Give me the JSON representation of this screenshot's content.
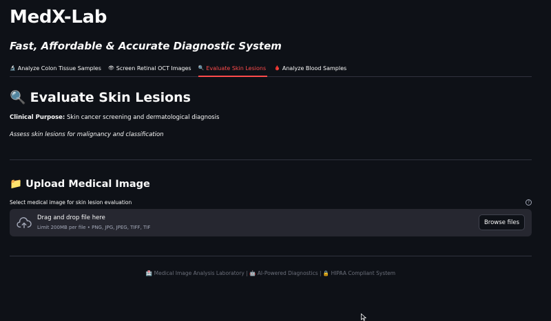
{
  "app": {
    "title": "MedX-Lab",
    "subtitle": "Fast, Affordable & Accurate Diagnostic System"
  },
  "tabs": [
    {
      "icon": "🔬",
      "label": "Analyze Colon Tissue Samples",
      "active": false
    },
    {
      "icon": "👁",
      "label": "Screen Retinal OCT Images",
      "active": false
    },
    {
      "icon": "🔍",
      "label": "Evaluate Skin Lesions",
      "active": true
    },
    {
      "icon": "🩸",
      "label": "Analyze Blood Samples",
      "active": false
    }
  ],
  "section": {
    "icon": "🔍",
    "title": "Evaluate Skin Lesions",
    "purpose_label": "Clinical Purpose:",
    "purpose_text": " Skin cancer screening and dermatological diagnosis",
    "assess": "Assess skin lesions for malignancy and classification"
  },
  "upload": {
    "icon": "📁",
    "title": "Upload Medical Image",
    "label": "Select medical image for skin lesion evaluation",
    "help_icon": "?",
    "drop_text": "Drag and drop file here",
    "limit_text": "Limit 200MB per file • PNG, JPG, JPEG, TIFF, TIF",
    "browse_label": "Browse files"
  },
  "footer": {
    "text": "🏥 Medical Image Analysis Laboratory | 🤖 AI-Powered Diagnostics | 🔒 HIPAA Compliant System"
  },
  "colors": {
    "background": "#0e1117",
    "accent": "#ff4b4b",
    "panel": "#262730"
  }
}
